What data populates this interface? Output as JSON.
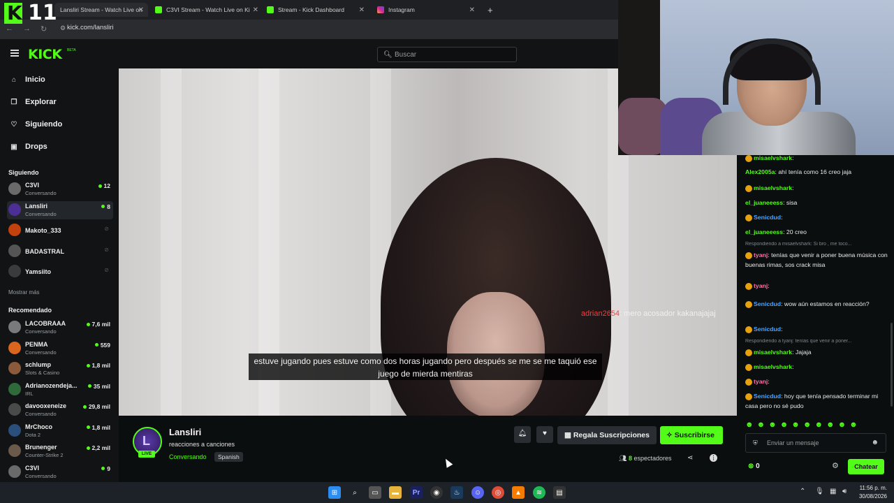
{
  "browser": {
    "tabs": [
      {
        "label": "Lansliri Stream - Watch Live on"
      },
      {
        "label": "C3VI Stream - Watch Live on Ki"
      },
      {
        "label": "Stream - Kick Dashboard"
      },
      {
        "label": "Instagram"
      }
    ],
    "url": "kick.com/lansliri"
  },
  "overlay": {
    "logo_letter": "K",
    "logo_number": "11"
  },
  "header": {
    "logo": "KICK",
    "beta": "BETA",
    "search_placeholder": "Buscar"
  },
  "nav": [
    {
      "label": "Inicio"
    },
    {
      "label": "Explorar"
    },
    {
      "label": "Siguiendo"
    },
    {
      "label": "Drops"
    }
  ],
  "following": {
    "title": "Siguiendo",
    "channels": [
      {
        "name": "C3VI",
        "category": "Conversando",
        "viewers": "12",
        "color": "#6a6a6a"
      },
      {
        "name": "Lansliri",
        "category": "Conversando",
        "viewers": "8",
        "color": "#4b2f94"
      },
      {
        "name": "Makoto_333",
        "category": "",
        "viewers": "",
        "color": "#c2410c"
      },
      {
        "name": "BADASTRAL",
        "category": "",
        "viewers": "",
        "color": "#555555"
      },
      {
        "name": "Yamsiito",
        "category": "",
        "viewers": "",
        "color": "#3b3b3b"
      }
    ],
    "more": "Mostrar más"
  },
  "recommended": {
    "title": "Recomendado",
    "channels": [
      {
        "name": "LACOBRAAA",
        "category": "Conversando",
        "viewers": "7,6 mil",
        "color": "#7a7a7a"
      },
      {
        "name": "PENMA",
        "category": "Conversando",
        "viewers": "559",
        "color": "#d9651f"
      },
      {
        "name": "schlump",
        "category": "Slots & Casino",
        "viewers": "1,8 mil",
        "color": "#8a5a3a"
      },
      {
        "name": "Adrianozendeja...",
        "category": "IRL",
        "viewers": "35 mil",
        "color": "#2f6b3a"
      },
      {
        "name": "davooxeneize",
        "category": "Conversando",
        "viewers": "29,8 mil",
        "color": "#4a4a4a"
      },
      {
        "name": "MrChoco",
        "category": "Dota 2",
        "viewers": "1,8 mil",
        "color": "#2a4f7a"
      },
      {
        "name": "Brunenger",
        "category": "Counter-Strike 2",
        "viewers": "2,2 mil",
        "color": "#6b5a4a"
      },
      {
        "name": "C3VI",
        "category": "Conversando",
        "viewers": "9",
        "color": "#6a6a6a"
      }
    ]
  },
  "video": {
    "subtitle": "estuve jugando pues estuve como dos horas jugando pero después se me se me taquió ese juego de mierda mentiras",
    "overlay_user": "adrian2654",
    "overlay_text": ": mero acosador kakanajajaj"
  },
  "chat": {
    "messages": [
      {
        "user": "misaelvshark",
        "text": ":",
        "color": "#53fc18",
        "badges": true
      },
      {
        "user": "Alex2005a",
        "text": ": ahí tenía como 16 creo jaja",
        "color": "#53fc18",
        "badges": false
      },
      {
        "user": "misaelvshark",
        "text": ":",
        "color": "#53fc18",
        "badges": true
      },
      {
        "user": "el_juaneeess",
        "text": ": sisa",
        "color": "#53fc18",
        "badges": false
      },
      {
        "user": "Senicdud",
        "text": ":",
        "color": "#4aa3ff",
        "badges": true
      },
      {
        "user": "el_juaneeess",
        "text": ": 20 creo",
        "color": "#53fc18",
        "badges": false
      },
      {
        "reply": "Respondiendo a misaelvshark: Si bro , me toco..."
      },
      {
        "user": "tyanj",
        "text": ": tenías que venir a poner buena música con buenas rimas, sos crack misa",
        "color": "#ff6ea8",
        "badges": true
      },
      {
        "user": "tyanj",
        "text": ":",
        "color": "#ff6ea8",
        "badges": true
      },
      {
        "user": "Senicdud",
        "text": ": wow aún estamos en reacción?",
        "color": "#4aa3ff",
        "badges": true
      },
      {
        "user": "Senicdud",
        "text": ":",
        "color": "#4aa3ff",
        "badges": true
      },
      {
        "reply": "Respondiendo a tyanj: tenías que venir a poner..."
      },
      {
        "user": "misaelvshark",
        "text": ": Jajaja",
        "color": "#53fc18",
        "badges": true
      },
      {
        "user": "misaelvshark",
        "text": ":",
        "color": "#53fc18",
        "badges": true
      },
      {
        "user": "tyanj",
        "text": ":",
        "color": "#ff6ea8",
        "badges": true
      },
      {
        "user": "Senicdud",
        "text": ": hoy que tenía pensado terminar mi casa pero no sé pudo",
        "color": "#4aa3ff",
        "badges": true
      }
    ],
    "input_placeholder": "Enviar un mensaje",
    "points": "0",
    "send_label": "Chatear"
  },
  "stream": {
    "name": "Lansliri",
    "avatar_letter": "L",
    "live_badge": "LIVE",
    "title": "reacciones a canciones",
    "category": "Conversando",
    "language": "Spanish",
    "gift_label": "Regala Suscripciones",
    "subscribe_label": "Suscribirse",
    "viewers": "8",
    "viewers_label": "espectadores"
  },
  "taskbar": {
    "time": "11:56 p. m.",
    "date": "30/08/2026"
  },
  "colors": {
    "accent": "#53fc18",
    "bg": "#0b0e0f",
    "sidebar": "#111314"
  }
}
